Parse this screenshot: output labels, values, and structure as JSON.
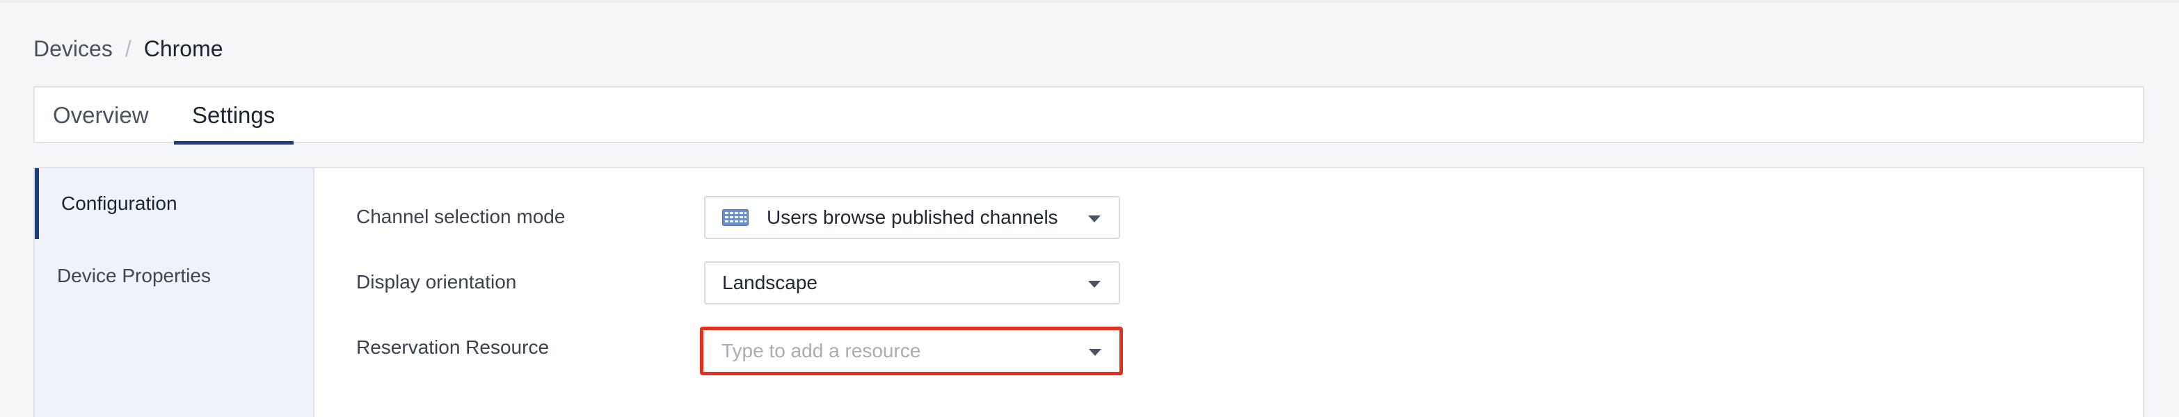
{
  "breadcrumb": {
    "parent": "Devices",
    "separator": "/",
    "current": "Chrome"
  },
  "tabs": [
    {
      "label": "Overview",
      "active": false
    },
    {
      "label": "Settings",
      "active": true
    }
  ],
  "sidebar": {
    "items": [
      {
        "label": "Configuration",
        "active": true
      },
      {
        "label": "Device Properties",
        "active": false
      }
    ]
  },
  "form": {
    "channel_selection_mode": {
      "label": "Channel selection mode",
      "value": "Users browse published channels",
      "icon": "channel-grid-icon"
    },
    "display_orientation": {
      "label": "Display orientation",
      "value": "Landscape"
    },
    "reservation_resource": {
      "label": "Reservation Resource",
      "placeholder": "Type to add a resource"
    }
  },
  "colors": {
    "accent": "#1e3b7c",
    "highlight": "#e0301e",
    "sidebar_bg": "#eef3fa"
  }
}
